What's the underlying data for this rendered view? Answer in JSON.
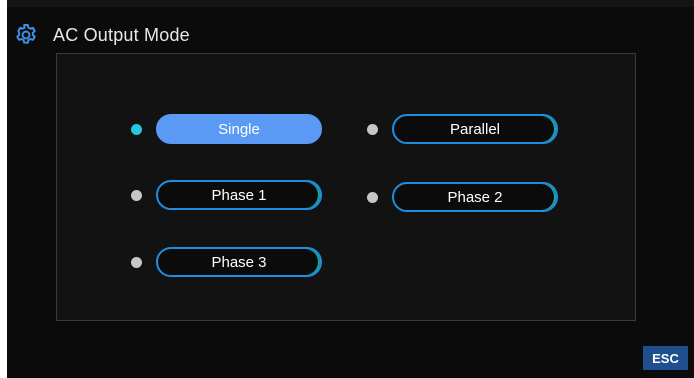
{
  "header": {
    "title": "AC Output Mode",
    "icon": "gear-icon"
  },
  "modes": [
    {
      "label": "Single",
      "selected": true
    },
    {
      "label": "Parallel",
      "selected": false
    },
    {
      "label": "Phase 1",
      "selected": false
    },
    {
      "label": "Phase 2",
      "selected": false
    },
    {
      "label": "Phase 3",
      "selected": false
    }
  ],
  "footer": {
    "esc_label": "ESC"
  },
  "colors": {
    "accent_selected": "#5b9af4",
    "border_unselected": "#1f8de0",
    "indicator_active": "#25c6df",
    "indicator_inactive": "#c7c7c7",
    "esc_background": "#1f4f8e"
  }
}
